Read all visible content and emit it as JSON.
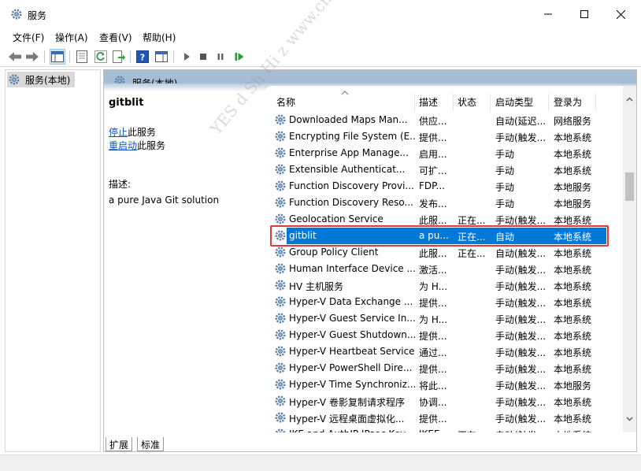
{
  "window": {
    "title": "服务",
    "icon": "gear-icon"
  },
  "menu": [
    {
      "label": "文件(F)"
    },
    {
      "label": "操作(A)"
    },
    {
      "label": "查看(V)"
    },
    {
      "label": "帮助(H)"
    }
  ],
  "tree": {
    "item_label": "服务(本地)"
  },
  "pane": {
    "header_label": "服务(本地)"
  },
  "detail": {
    "service_name": "gitblit",
    "stop_link": "停止",
    "stop_suffix": "此服务",
    "restart_link": "重启动",
    "restart_suffix": "此服务",
    "desc_label": "描述:",
    "desc_text": "a pure Java Git solution"
  },
  "columns": {
    "name": "名称",
    "desc": "描述",
    "status": "状态",
    "startup": "启动类型",
    "logon": "登录为"
  },
  "rows": [
    {
      "name": "Downloaded Maps Man...",
      "desc": "供应...",
      "status": "",
      "startup": "自动(延迟...",
      "logon": "网络服务"
    },
    {
      "name": "Encrypting File System (E...",
      "desc": "提供...",
      "status": "",
      "startup": "手动(触发...",
      "logon": "本地系统"
    },
    {
      "name": "Enterprise App Manage...",
      "desc": "启用...",
      "status": "",
      "startup": "手动",
      "logon": "本地系统"
    },
    {
      "name": "Extensible Authenticat...",
      "desc": "可扩...",
      "status": "",
      "startup": "手动",
      "logon": "本地系统"
    },
    {
      "name": "Function Discovery Provi...",
      "desc": "FDP...",
      "status": "",
      "startup": "手动",
      "logon": "本地服务"
    },
    {
      "name": "Function Discovery Reso...",
      "desc": "发布...",
      "status": "",
      "startup": "手动",
      "logon": "本地服务"
    },
    {
      "name": "Geolocation Service",
      "desc": "此服...",
      "status": "正在...",
      "startup": "手动(触发...",
      "logon": "本地系统"
    },
    {
      "name": "gitblit",
      "desc": "a pu...",
      "status": "正在...",
      "startup": "自动",
      "logon": "本地系统",
      "selected": true
    },
    {
      "name": "Group Policy Client",
      "desc": "此服...",
      "status": "正在...",
      "startup": "自动(触发...",
      "logon": "本地系统"
    },
    {
      "name": "Human Interface Device ...",
      "desc": "激活...",
      "status": "",
      "startup": "手动(触发...",
      "logon": "本地系统"
    },
    {
      "name": "HV 主机服务",
      "desc": "为 H...",
      "status": "",
      "startup": "手动(触发...",
      "logon": "本地系统"
    },
    {
      "name": "Hyper-V Data Exchange ...",
      "desc": "提供...",
      "status": "",
      "startup": "手动(触发...",
      "logon": "本地系统"
    },
    {
      "name": "Hyper-V Guest Service In...",
      "desc": "为 H...",
      "status": "",
      "startup": "手动(触发...",
      "logon": "本地系统"
    },
    {
      "name": "Hyper-V Guest Shutdown...",
      "desc": "提供...",
      "status": "",
      "startup": "手动(触发...",
      "logon": "本地系统"
    },
    {
      "name": "Hyper-V Heartbeat Service",
      "desc": "通过...",
      "status": "",
      "startup": "手动(触发...",
      "logon": "本地系统"
    },
    {
      "name": "Hyper-V PowerShell Dire...",
      "desc": "提供...",
      "status": "",
      "startup": "手动(触发...",
      "logon": "本地系统"
    },
    {
      "name": "Hyper-V Time Synchroniz...",
      "desc": "将此...",
      "status": "",
      "startup": "手动(触发...",
      "logon": "本地服务"
    },
    {
      "name": "Hyper-V 卷影复制请求程序",
      "desc": "协调...",
      "status": "",
      "startup": "手动(触发...",
      "logon": "本地系统"
    },
    {
      "name": "Hyper-V 远程桌面虚拟化...",
      "desc": "提供...",
      "status": "",
      "startup": "手动(触发...",
      "logon": "本地系统"
    },
    {
      "name": "IKE and AuthIP IPsec Key...",
      "desc": "IKEE...",
      "status": "正在...",
      "startup": "自动(触发...",
      "logon": "本地系统"
    }
  ],
  "tabs": [
    {
      "label": "扩展"
    },
    {
      "label": "标准"
    }
  ],
  "watermark": "YES  d Sh Hi z  www.cnblogs.com"
}
